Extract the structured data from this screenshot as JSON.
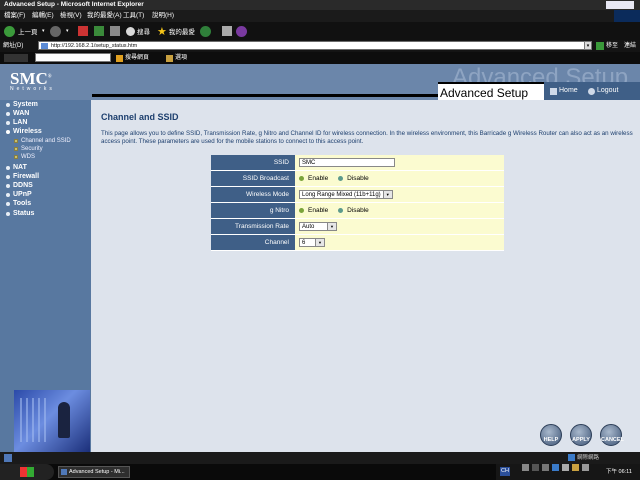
{
  "window": {
    "title": "Advanced Setup - Microsoft Internet Explorer"
  },
  "menu": [
    "檔案(F)",
    "編輯(E)",
    "檢視(V)",
    "我的最愛(A)",
    "工具(T)",
    "說明(H)"
  ],
  "toolbar": {
    "back": "上一頁",
    "search": "搜尋",
    "favorites": "我的最愛"
  },
  "address": {
    "label": "網址(D)",
    "url": "http://192.168.2.1/setup_status.htm",
    "go": "移至",
    "links": "連結"
  },
  "linksbar": {
    "search_web": "搜尋網頁",
    "options": "選項"
  },
  "header": {
    "logo": "SMC",
    "logo_sub": "Networks",
    "watermark": "Advanced Setup",
    "title": "Advanced Setup",
    "home": "Home",
    "logout": "Logout"
  },
  "nav": {
    "items": [
      "System",
      "WAN",
      "LAN",
      "Wireless",
      "NAT",
      "Firewall",
      "DDNS",
      "UPnP",
      "Tools",
      "Status"
    ],
    "wireless_sub": [
      "Channel and SSID",
      "Security",
      "WDS"
    ]
  },
  "content": {
    "title": "Channel and SSID",
    "description": "This page allows you to define SSID, Transmission Rate, g Nitro and Channel ID for wireless connection.  In the wireless environment, this Barricade g Wireless Router can also act as an wireless access point.  These parameters are used for the mobile stations to connect to this access point."
  },
  "form": {
    "ssid": {
      "label": "SSID",
      "value": "SMC"
    },
    "broadcast": {
      "label": "SSID Broadcast",
      "enable": "Enable",
      "disable": "Disable"
    },
    "mode": {
      "label": "Wireless Mode",
      "value": "Long Range Mixed (11b+11g)"
    },
    "nitro": {
      "label": "g Nitro",
      "enable": "Enable",
      "disable": "Disable"
    },
    "rate": {
      "label": "Transmission Rate",
      "value": "Auto"
    },
    "channel": {
      "label": "Channel",
      "value": "6"
    }
  },
  "buttons": {
    "help": "HELP",
    "apply": "APPLY",
    "cancel": "CANCEL"
  },
  "statusbar": {
    "zone": "網際網路"
  },
  "taskbar": {
    "item": "Advanced Setup - Mi...",
    "lang": "CH",
    "time": "下午 06:11"
  },
  "colors": {
    "accent": "#3f5f87",
    "sidebar": "#5878a0",
    "form_value_bg": "#fbfbd0"
  }
}
